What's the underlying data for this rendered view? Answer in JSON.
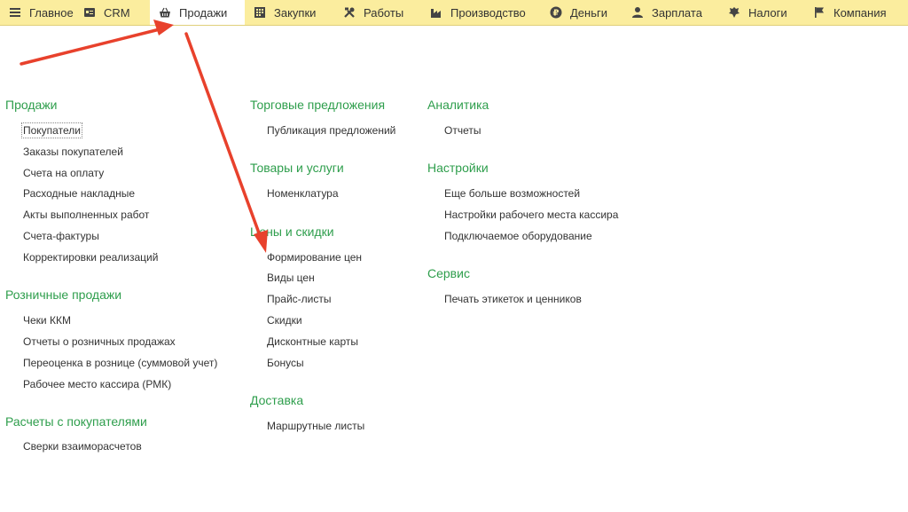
{
  "nav": {
    "items": [
      {
        "label": "Главное",
        "icon": "menu-icon"
      },
      {
        "label": "CRM",
        "icon": "crm-card-icon"
      },
      {
        "label": "Продажи",
        "icon": "basket-icon"
      },
      {
        "label": "Закупки",
        "icon": "purchases-icon"
      },
      {
        "label": "Работы",
        "icon": "tools-icon"
      },
      {
        "label": "Производство",
        "icon": "factory-icon"
      },
      {
        "label": "Деньги",
        "icon": "ruble-coin-icon"
      },
      {
        "label": "Зарплата",
        "icon": "person-icon"
      },
      {
        "label": "Налоги",
        "icon": "emblem-icon"
      },
      {
        "label": "Компания",
        "icon": "flag-icon"
      }
    ],
    "active": "Продажи"
  },
  "sections": {
    "sales": {
      "title": "Продажи",
      "items": [
        "Покупатели",
        "Заказы покупателей",
        "Счета на оплату",
        "Расходные накладные",
        "Акты выполненных работ",
        "Счета-фактуры",
        "Корректировки реализаций"
      ]
    },
    "retail": {
      "title": "Розничные продажи",
      "items": [
        "Чеки ККМ",
        "Отчеты о розничных продажах",
        "Переоценка в рознице (суммовой учет)",
        "Рабочее место кассира (РМК)"
      ]
    },
    "settlements": {
      "title": "Расчеты с покупателями",
      "items": [
        "Сверки взаиморасчетов"
      ]
    },
    "trade_offers": {
      "title": "Торговые предложения",
      "items": [
        "Публикация предложений"
      ]
    },
    "goods": {
      "title": "Товары и услуги",
      "items": [
        "Номенклатура"
      ]
    },
    "prices": {
      "title": "Цены и скидки",
      "items": [
        "Формирование цен",
        "Виды цен",
        "Прайс-листы",
        "Скидки",
        "Дисконтные карты",
        "Бонусы"
      ]
    },
    "delivery": {
      "title": "Доставка",
      "items": [
        "Маршрутные листы"
      ]
    },
    "analytics": {
      "title": "Аналитика",
      "items": [
        "Отчеты"
      ]
    },
    "settings": {
      "title": "Настройки",
      "items": [
        "Еще больше возможностей",
        "Настройки рабочего места кассира",
        "Подключаемое оборудование"
      ]
    },
    "service": {
      "title": "Сервис",
      "items": [
        "Печать этикеток и ценников"
      ]
    }
  },
  "colors": {
    "nav_bg": "#fbed9e",
    "section_title": "#2e9e4c",
    "arrow": "#e8412c"
  }
}
